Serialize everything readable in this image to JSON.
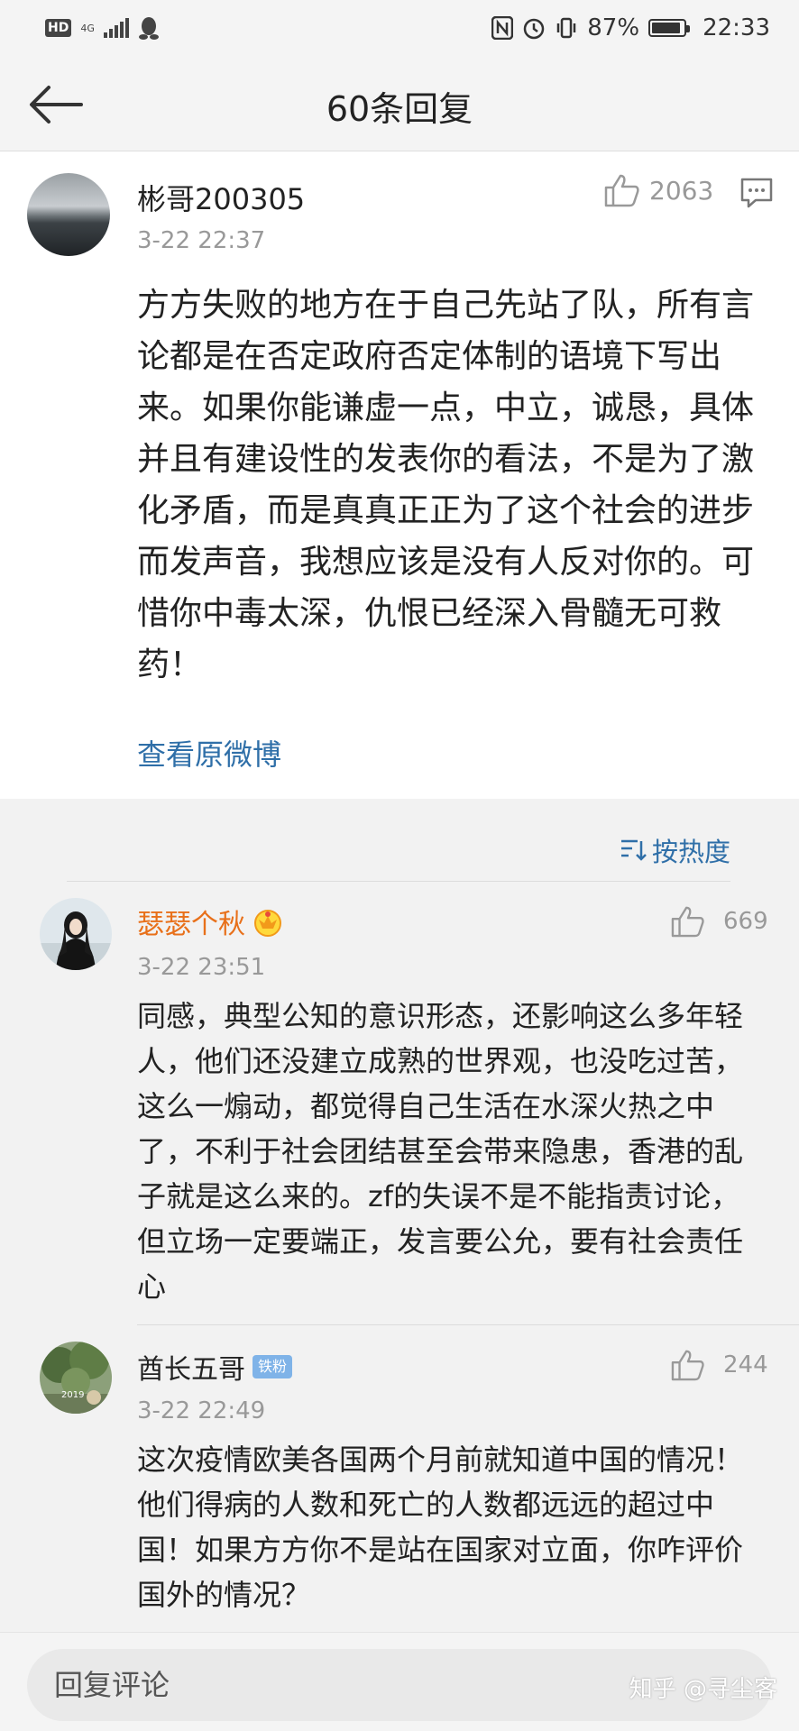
{
  "status_bar": {
    "hd": "HD",
    "network": "4G",
    "battery": "87%",
    "time": "22:33"
  },
  "header": {
    "title": "60条回复"
  },
  "main_comment": {
    "username": "彬哥200305",
    "time": "3-22 22:37",
    "likes": "2063",
    "text": "方方失败的地方在于自己先站了队，所有言论都是在否定政府否定体制的语境下写出来。如果你能谦虚一点，中立，诚恳，具体并且有建设性的发表你的看法，不是为了激化矛盾，而是真真正正为了这个社会的进步而发声音，我想应该是没有人反对你的。可惜你中毒太深，仇恨已经深入骨髓无可救药！",
    "view_original": "查看原微博"
  },
  "sort": {
    "label": "按热度"
  },
  "replies": [
    {
      "username": "瑟瑟个秋",
      "time": "3-22 23:51",
      "likes": "669",
      "text": "同感，典型公知的意识形态，还影响这么多年轻人，他们还没建立成熟的世界观，也没吃过苦，这么一煽动，都觉得自己生活在水深火热之中了，不利于社会团结甚至会带来隐患，香港的乱子就是这么来的。zf的失误不是不能指责讨论，但立场一定要端正，发言要公允，要有社会责任心"
    },
    {
      "username": "酋长五哥",
      "badge": "铁粉",
      "time": "3-22 22:49",
      "likes": "244",
      "text": "这次疫情欧美各国两个月前就知道中国的情况！他们得病的人数和死亡的人数都远远的超过中国！如果方方你不是站在国家对立面，你咋评价国外的情况？",
      "avatar_caption": "2019"
    }
  ],
  "bottom": {
    "placeholder": "回复评论",
    "watermark": "知乎 @寻尘客"
  },
  "colors": {
    "link": "#2f6fa8",
    "username_vip": "#e8701a",
    "muted": "#999999"
  }
}
